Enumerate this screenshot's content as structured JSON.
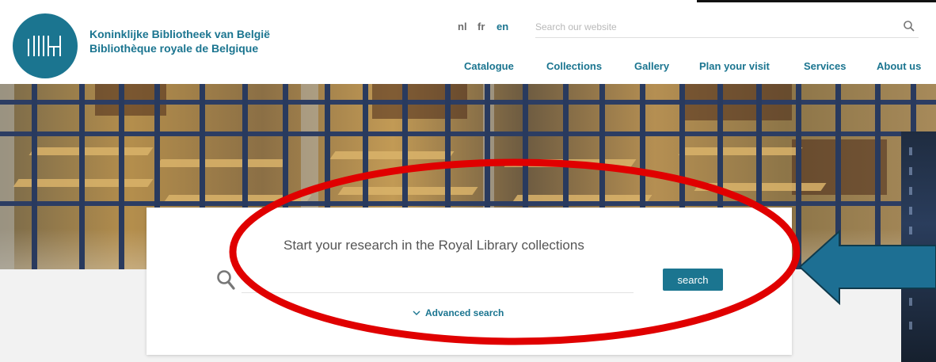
{
  "header": {
    "logo_line1": "Koninklijke Bibliotheek van België",
    "logo_line2": "Bibliothèque royale de Belgique",
    "languages": [
      {
        "code": "nl",
        "active": false
      },
      {
        "code": "fr",
        "active": false
      },
      {
        "code": "en",
        "active": true
      }
    ],
    "search_placeholder": "Search our website",
    "nav": [
      {
        "label": "Catalogue"
      },
      {
        "label": "Collections"
      },
      {
        "label": "Gallery"
      },
      {
        "label": "Plan your visit"
      },
      {
        "label": "Services"
      },
      {
        "label": "About us"
      }
    ]
  },
  "search_card": {
    "title": "Start your research in the Royal Library collections",
    "input_value": "",
    "button_label": "search",
    "advanced_label": "Advanced search"
  },
  "icons": {
    "site_search": "search-icon",
    "card_search": "magnifier-icon",
    "advanced_toggle": "chevron-down-icon",
    "logo": "library-logo-icon"
  },
  "colors": {
    "brand": "#1b7590",
    "annotation_ellipse": "#e00000",
    "annotation_arrow": "#1d6f93"
  }
}
